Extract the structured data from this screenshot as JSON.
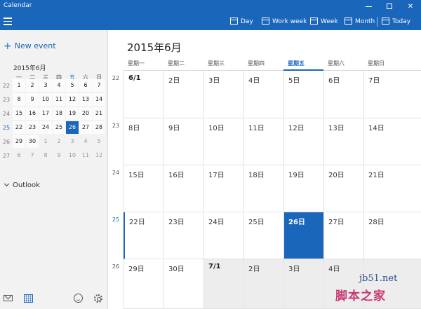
{
  "window": {
    "title": "Calendar"
  },
  "toolbar": {
    "day": "Day",
    "work_week": "Work week",
    "week": "Week",
    "month": "Month",
    "today": "Today"
  },
  "sidebar": {
    "new_event": "New event",
    "mini_title": "2015年6月",
    "weekday_headers": [
      "一",
      "二",
      "三",
      "四",
      "五",
      "六",
      "日"
    ],
    "week_numbers": [
      "22",
      "23",
      "24",
      "25",
      "26",
      "27"
    ],
    "days": [
      [
        "1",
        "2",
        "3",
        "4",
        "5",
        "6",
        "7"
      ],
      [
        "8",
        "9",
        "10",
        "11",
        "12",
        "13",
        "14"
      ],
      [
        "15",
        "16",
        "17",
        "18",
        "19",
        "20",
        "21"
      ],
      [
        "22",
        "23",
        "24",
        "25",
        "26",
        "27",
        "28"
      ],
      [
        "29",
        "30",
        "1",
        "2",
        "3",
        "4",
        "5"
      ],
      [
        "6",
        "7",
        "8",
        "9",
        "10",
        "11",
        "12"
      ]
    ],
    "outlook": "Outlook"
  },
  "main": {
    "month_title": "2015年6月",
    "weekdays": [
      "星期一",
      "星期二",
      "星期三",
      "星期四",
      "星期五",
      "星期六",
      "星期日"
    ],
    "week_numbers": [
      "22",
      "23",
      "24",
      "25",
      "26"
    ],
    "cells": [
      [
        "6/1",
        "2日",
        "3日",
        "4日",
        "5日",
        "6日",
        "7日"
      ],
      [
        "8日",
        "9日",
        "10日",
        "11日",
        "12日",
        "13日",
        "14日"
      ],
      [
        "15日",
        "16日",
        "17日",
        "18日",
        "19日",
        "20日",
        "21日"
      ],
      [
        "22日",
        "23日",
        "24日",
        "25日",
        "26日",
        "27日",
        "28日"
      ],
      [
        "29日",
        "30日",
        "7/1",
        "2日",
        "3日",
        "4日",
        ""
      ]
    ]
  },
  "watermark": {
    "site": "jb51.net",
    "name": "脚本之家"
  },
  "colors": {
    "accent": "#1a66ba",
    "sidebar_bg": "#f2f2f2",
    "other_month_bg": "#ededed"
  }
}
